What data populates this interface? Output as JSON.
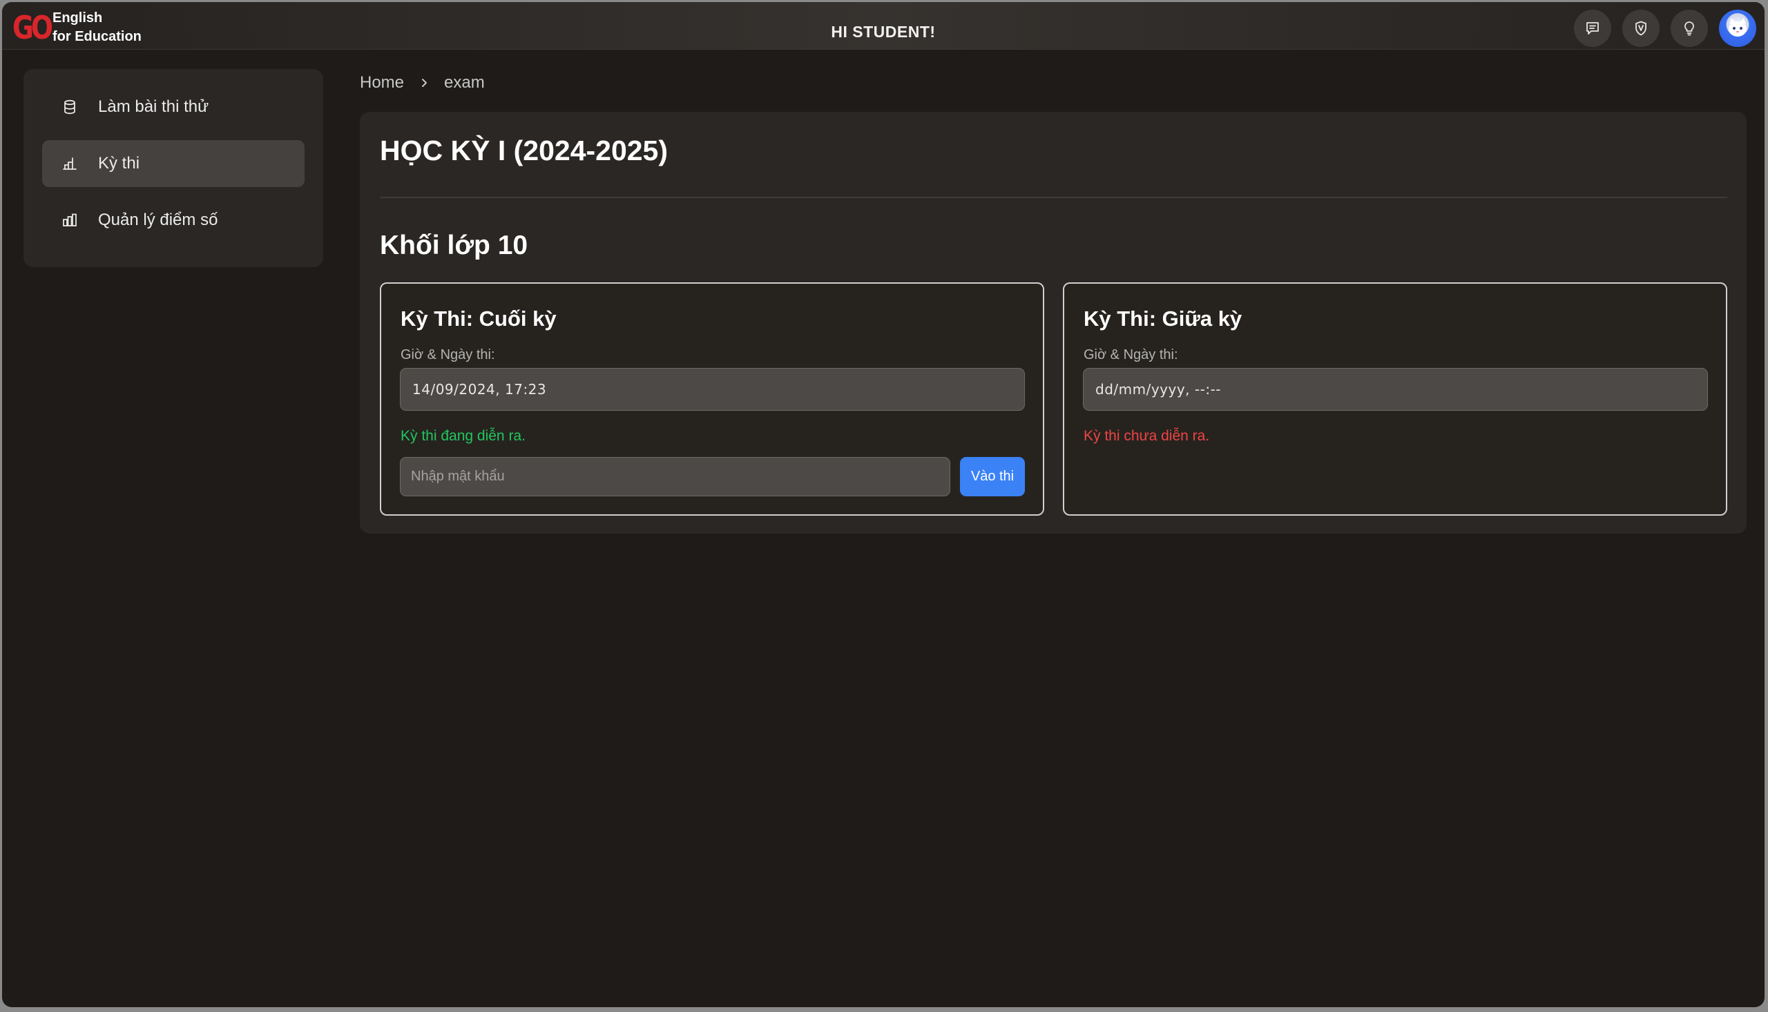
{
  "header": {
    "logo_mark": "GO",
    "logo_line1": "English",
    "logo_line2": "for Education",
    "greeting": "HI STUDENT!",
    "actions": [
      {
        "icon": "chat-icon"
      },
      {
        "icon": "vocab-badge-icon"
      },
      {
        "icon": "lightbulb-icon"
      },
      {
        "icon": "user-avatar"
      }
    ]
  },
  "sidebar": {
    "items": [
      {
        "label": "Làm bài thi thử",
        "icon": "database-icon",
        "active": false
      },
      {
        "label": "Kỳ thi",
        "icon": "exam-chart-icon",
        "active": true
      },
      {
        "label": "Quản lý điểm số",
        "icon": "bar-chart-icon",
        "active": false
      }
    ]
  },
  "breadcrumb": {
    "home": "Home",
    "current": "exam"
  },
  "main": {
    "term_title": "HỌC KỲ I (2024-2025)",
    "grade_title": "Khối lớp 10",
    "exams": [
      {
        "title": "Kỳ Thi: Cuối kỳ",
        "datetime_label": "Giờ & Ngày thi:",
        "datetime_value": "14/09/2024, 17:23",
        "status": "Kỳ thi đang diễn ra.",
        "status_color": "#22c55e",
        "password_placeholder": "Nhập mật khẩu",
        "enter_button": "Vào thi"
      },
      {
        "title": "Kỳ Thi: Giữa kỳ",
        "datetime_label": "Giờ & Ngày thi:",
        "datetime_value": "dd/mm/yyyy, --:--",
        "status": "Kỳ thi chưa diễn ra.",
        "status_color": "#ef4444"
      }
    ]
  },
  "colors": {
    "background": "#1e1b18",
    "panel": "#2a2724",
    "accent": "#3b82f6",
    "logo": "#d8262b"
  }
}
